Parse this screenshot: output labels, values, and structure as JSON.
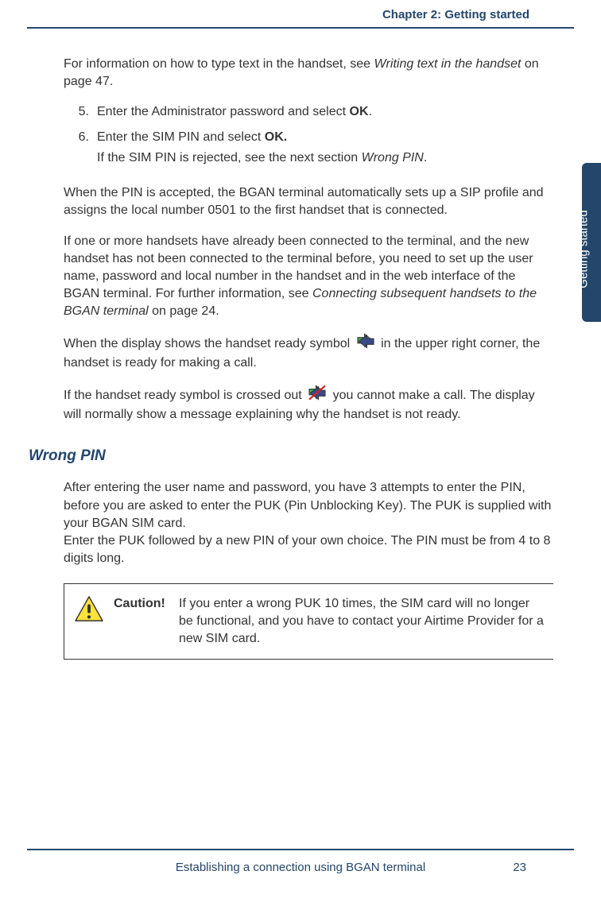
{
  "header": {
    "chapter": "Chapter 2:  Getting started"
  },
  "sideTab": "Getting started",
  "body": {
    "intro_a": "For information on how to type text in the handset, see ",
    "intro_ref": "Writing text in the handset",
    "intro_b": " on page 47.",
    "step5_num": "5.",
    "step5_a": "Enter the Administrator password and select ",
    "step5_ok": "OK",
    "step5_b": ".",
    "step6_num": "6.",
    "step6_a": "Enter the SIM PIN and select ",
    "step6_ok": "OK.",
    "step6_sub_a": "If the SIM PIN is rejected, see the next section ",
    "step6_sub_ref": "Wrong PIN",
    "step6_sub_b": ".",
    "para2": "When the PIN is accepted, the BGAN terminal automatically sets up a SIP profile and assigns the local number 0501 to the first handset that is connected.",
    "para3_a": "If one or more handsets have already been connected to the terminal, and the new handset has not been connected to the terminal before, you need to set up the user name, password and local number in the handset and in the web interface of the BGAN terminal. For further information, see ",
    "para3_ref": "Connecting subsequent handsets to the BGAN terminal",
    "para3_b": " on page 24.",
    "para4_a": "When the display shows the handset ready symbol ",
    "para4_b": " in the upper right corner, the handset is ready for making a call.",
    "para5_a": "If the handset ready symbol is crossed out ",
    "para5_b": " you cannot make a call. The display will normally show a message explaining why the handset is not ready.",
    "wrong_pin_heading": "Wrong PIN",
    "wrong_pin_para_1": "After entering the user name and password, you have 3 attempts to enter the PIN, before you are asked to enter the PUK (Pin Unblocking Key). The PUK is supplied with your BGAN SIM card.",
    "wrong_pin_para_2": "Enter the PUK followed by a new PIN of your own choice. The PIN must be from 4 to 8 digits long.",
    "caution_label": "Caution!",
    "caution_text": "If you enter a wrong PUK 10 times, the SIM card will no longer be functional, and you have to contact your Airtime Provider for a new SIM card."
  },
  "footer": {
    "title": "Establishing a connection using BGAN terminal",
    "page": "23"
  }
}
